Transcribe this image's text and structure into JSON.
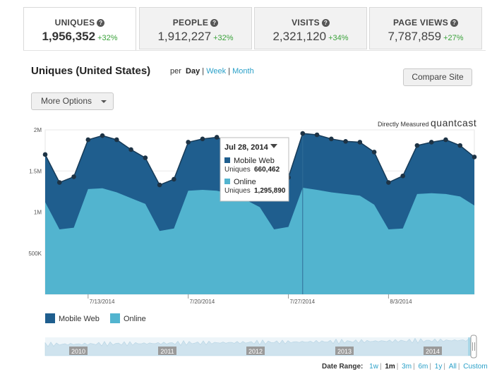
{
  "tabs": [
    {
      "label": "UNIQUES",
      "value": "1,956,352",
      "change": "+32%",
      "active": true
    },
    {
      "label": "PEOPLE",
      "value": "1,912,227",
      "change": "+32%",
      "active": false
    },
    {
      "label": "VISITS",
      "value": "2,321,120",
      "change": "+34%",
      "active": false
    },
    {
      "label": "PAGE VIEWS",
      "value": "7,787,859",
      "change": "+27%",
      "active": false
    }
  ],
  "header": {
    "title": "Uniques (United States)",
    "per_label": "per",
    "period_day": "Day",
    "period_week": "Week",
    "period_month": "Month",
    "sep": "|"
  },
  "buttons": {
    "compare": "Compare Site",
    "more_options": "More Options"
  },
  "branding": {
    "measured": "Directly Measured",
    "logo": "quantcast"
  },
  "tooltip": {
    "date": "Jul 28, 2014",
    "series1_name": "Mobile Web",
    "series1_metric": "Uniques",
    "series1_value": "660,462",
    "series2_name": "Online",
    "series2_metric": "Uniques",
    "series2_value": "1,295,890"
  },
  "legend": [
    {
      "name": "Mobile Web",
      "color": "#1f5e8e"
    },
    {
      "name": "Online",
      "color": "#52b4cf"
    }
  ],
  "navigator": {
    "years": [
      "2010",
      "2011",
      "2012",
      "2013",
      "2014"
    ]
  },
  "date_range": {
    "label": "Date Range:",
    "options": [
      "1w",
      "1m",
      "3m",
      "6m",
      "1y",
      "All",
      "Custom"
    ],
    "selected": "1m"
  },
  "colors": {
    "mobile": "#1f5e8e",
    "online": "#52b4cf",
    "accent_link": "#2aa0c8",
    "positive": "#3aa23a"
  },
  "chart_data": {
    "type": "area",
    "stacked": true,
    "x_ticks": [
      "7/13/2014",
      "7/20/2014",
      "7/27/2014",
      "8/3/2014"
    ],
    "y_ticks": [
      "500K",
      "1M",
      "1.5M",
      "2M"
    ],
    "ylim": [
      0,
      2000000
    ],
    "x": [
      "2014-07-10",
      "2014-07-11",
      "2014-07-12",
      "2014-07-13",
      "2014-07-14",
      "2014-07-15",
      "2014-07-16",
      "2014-07-17",
      "2014-07-18",
      "2014-07-19",
      "2014-07-20",
      "2014-07-21",
      "2014-07-22",
      "2014-07-23",
      "2014-07-24",
      "2014-07-25",
      "2014-07-26",
      "2014-07-27",
      "2014-07-28",
      "2014-07-29",
      "2014-07-30",
      "2014-07-31",
      "2014-08-01",
      "2014-08-02",
      "2014-08-03",
      "2014-08-04",
      "2014-08-05",
      "2014-08-06",
      "2014-08-07",
      "2014-08-08",
      "2014-08-09"
    ],
    "series": [
      {
        "name": "Online",
        "values": [
          1120000,
          790000,
          810000,
          1280000,
          1290000,
          1240000,
          1170000,
          1100000,
          770000,
          800000,
          1260000,
          1270000,
          1260000,
          1220000,
          1150000,
          1060000,
          790000,
          820000,
          1295890,
          1270000,
          1240000,
          1220000,
          1200000,
          1090000,
          790000,
          800000,
          1220000,
          1230000,
          1220000,
          1190000,
          1080000
        ]
      },
      {
        "name": "Mobile Web",
        "values": [
          580000,
          570000,
          620000,
          600000,
          640000,
          640000,
          590000,
          560000,
          560000,
          600000,
          590000,
          620000,
          650000,
          620000,
          620000,
          700000,
          620000,
          600000,
          660462,
          670000,
          650000,
          640000,
          650000,
          640000,
          570000,
          640000,
          590000,
          620000,
          660000,
          620000,
          590000
        ]
      }
    ],
    "highlight_index": 18
  }
}
